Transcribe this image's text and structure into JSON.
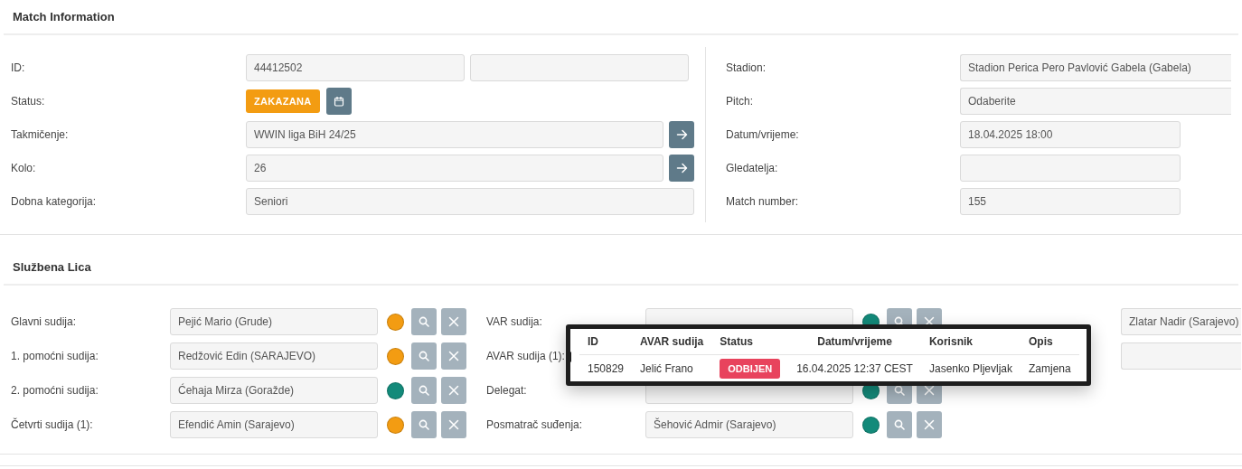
{
  "match_information": {
    "title": "Match Information",
    "left_rows": [
      {
        "kind": "pair",
        "label": "ID:",
        "value": "44412502"
      },
      {
        "kind": "status",
        "label": "Status:",
        "badge": "ZAKAZANA"
      },
      {
        "kind": "link",
        "label": "Takmičenje:",
        "value": "WWIN liga BiH 24/25"
      },
      {
        "kind": "link",
        "label": "Kolo:",
        "value": "26"
      },
      {
        "kind": "wide",
        "label": "Dobna kategorija:",
        "value": "Seniori"
      }
    ],
    "right_rows": [
      {
        "kind": "full",
        "label": "Stadion:",
        "value": "Stadion Perica Pero Pavlović Gabela (Gabela)"
      },
      {
        "kind": "full",
        "label": "Pitch:",
        "value": "Odaberite"
      },
      {
        "kind": "short",
        "label": "Datum/vrijeme:",
        "value": "18.04.2025 18:00"
      },
      {
        "kind": "short",
        "label": "Gledatelja:"
      },
      {
        "kind": "short",
        "label": "Match number:",
        "value": "155"
      }
    ]
  },
  "officials": {
    "title": "Službena Lica",
    "columns": [
      {
        "rows": [
          {
            "kind": "official",
            "label": "Glavni sudija:",
            "value": "Pejić Mario (Grude)",
            "color": "#f39c12"
          },
          {
            "kind": "official",
            "label": "1. pomoćni sudija:",
            "value": "Redžović Edin (SARAJEVO)",
            "color": "#f39c12"
          },
          {
            "kind": "official",
            "label": "2. pomoćni sudija:",
            "value": "Ćehaja Mirza (Goražde)",
            "color": "#138a7a"
          },
          {
            "kind": "official",
            "label": "Četvrti sudija (1):",
            "value": "Efendić Amin (Sarajevo)",
            "color": "#f39c12"
          }
        ]
      },
      {
        "rows": [
          {
            "kind": "official",
            "label": "VAR sudija:",
            "color": "#138a7a"
          },
          {
            "kind": "label",
            "label": "AVAR sudija (1):"
          },
          {
            "kind": "official",
            "label": "Delegat:",
            "color": "#138a7a"
          },
          {
            "kind": "official",
            "label": "Posmatrač suđenja:",
            "value": "Šehović Admir (Sarajevo)",
            "color": "#138a7a"
          }
        ]
      },
      {
        "rows": [
          {
            "kind": "plain",
            "value": "Zlatar Nadir (Sarajevo)"
          },
          {
            "kind": "plain"
          }
        ]
      }
    ]
  },
  "history_popup": {
    "columns": [
      "ID",
      "AVAR sudija",
      "Status",
      "Datum/vrijeme",
      "Korisnik",
      "Opis"
    ],
    "rows": [
      {
        "cells": [
          {
            "kind": "text",
            "text": "150829"
          },
          {
            "kind": "text",
            "text": "Jelić Frano"
          },
          {
            "kind": "badge",
            "text": "ODBIJEN"
          },
          {
            "kind": "text",
            "text": "16.04.2025 12:37 CEST"
          },
          {
            "kind": "text",
            "text": "Jasenko Pljevljak"
          },
          {
            "kind": "text",
            "text": "Zamjena"
          }
        ]
      }
    ]
  }
}
